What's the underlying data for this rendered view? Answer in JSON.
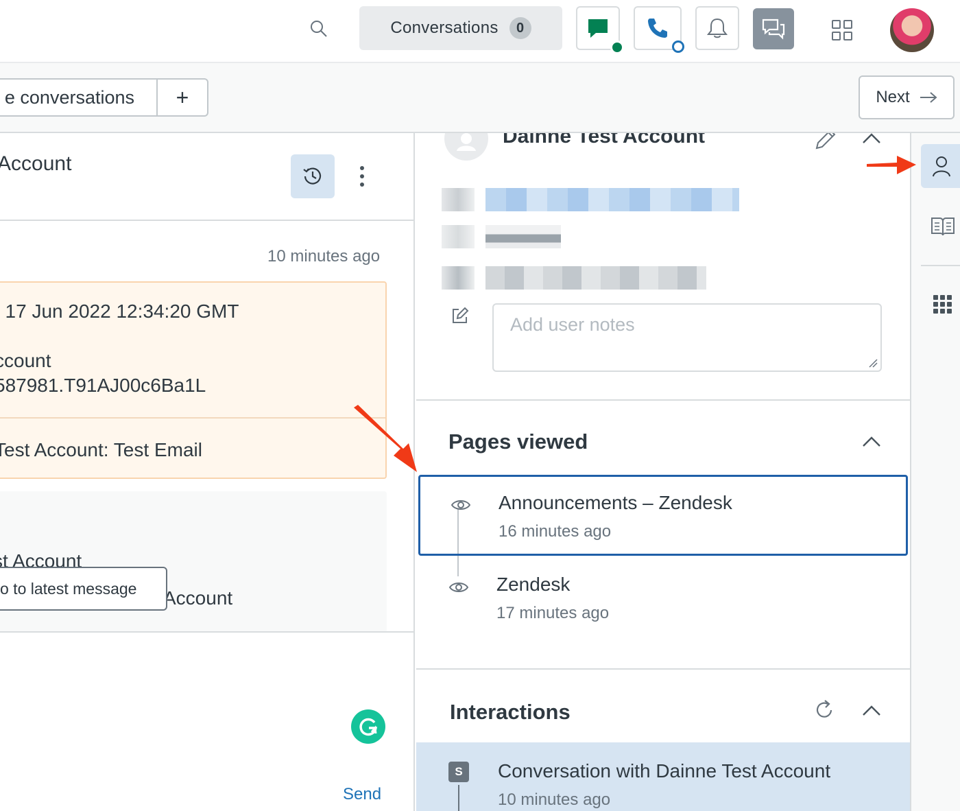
{
  "topbar": {
    "conversations_label": "Conversations",
    "conversations_count": "0"
  },
  "subbar": {
    "tab_label": "e conversations",
    "add_label": "+",
    "next_label": "Next"
  },
  "conversation": {
    "title": "Account",
    "message_time": "10 minutes ago",
    "card_line1": ", 17 Jun 2022 12:34:20 GMT",
    "card_line2": "ccount",
    "card_line3": "587981.T91AJ00c6Ba1L",
    "card_line4": "Test Account: Test Email",
    "card2_line1": "st Account",
    "card2_line2": "Account",
    "jump_label": "o to latest message",
    "send_label": "Send"
  },
  "context": {
    "user_name": "Dainne Test Account",
    "notes_placeholder": "Add user notes",
    "pages_viewed_title": "Pages viewed",
    "pages": [
      {
        "title": "Announcements – Zendesk",
        "time": "16 minutes ago"
      },
      {
        "title": "Zendesk",
        "time": "17 minutes ago"
      }
    ],
    "interactions_title": "Interactions",
    "interactions": [
      {
        "badge": "S",
        "title": "Conversation with Dainne Test Account",
        "time": "10 minutes ago"
      }
    ]
  },
  "icons": {
    "search": "search-icon",
    "messaging": "chat-bubble-icon",
    "phone": "phone-icon",
    "notifications": "bell-icon",
    "chat": "chat-icon",
    "apps": "apps-grid-icon",
    "history": "history-icon",
    "more": "more-vertical-icon",
    "edit": "pencil-icon",
    "notes": "notes-edit-icon",
    "eye": "eye-icon",
    "refresh": "refresh-icon",
    "user": "user-icon",
    "knowledge": "book-icon",
    "apps_rail": "dot-grid-icon"
  },
  "colors": {
    "accent_blue": "#1f73b7",
    "online_green": "#038153",
    "annotation_red": "#f03a17",
    "highlight_bg": "#d6e4f2",
    "message_bg": "#fff7ed"
  }
}
